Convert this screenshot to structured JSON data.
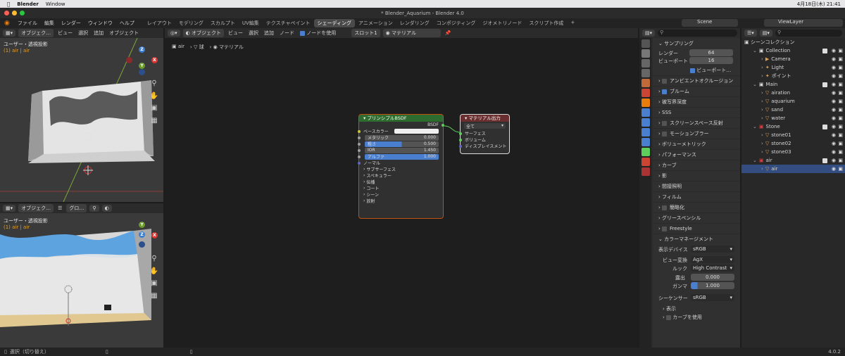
{
  "mac_menu": {
    "app": "Blender",
    "window": "Window",
    "clock": "4月18日(木) 21:41"
  },
  "window_title": "* Blender_Aquarium - Blender 4.0",
  "menus": [
    "ファイル",
    "編集",
    "レンダー",
    "ウィンドウ",
    "ヘルプ"
  ],
  "workspaces": [
    "レイアウト",
    "モデリング",
    "スカルプト",
    "UV編集",
    "テクスチャペイント",
    "シェーディング",
    "アニメーション",
    "レンダリング",
    "コンポジティング",
    "ジオメトリノード",
    "スクリプト作成"
  ],
  "active_workspace_index": 5,
  "add_tab": "+",
  "scene": {
    "label": "Scene",
    "viewlayer": "ViewLayer"
  },
  "viewport_top": {
    "mode": "オブジェク…",
    "menus": [
      "ビュー",
      "選択",
      "追加",
      "オブジェクト"
    ],
    "title": "ユーザー・透視投影",
    "subtitle": "(1) air | air"
  },
  "viewport_bottom": {
    "mode": "オブジェク…",
    "transform": "グロ…",
    "title": "ユーザー・透視投影",
    "subtitle": "(1) air | air"
  },
  "gizmo": {
    "z": "Z",
    "x": "X",
    "y": "Y"
  },
  "node_editor": {
    "mode": "オブジェクト",
    "menus": [
      "ビュー",
      "選択",
      "追加",
      "ノード"
    ],
    "use_nodes": "ノードを使用",
    "slot": "スロット1",
    "material": "マテリアル",
    "breadcrumb": [
      "air",
      "球",
      "マテリアル"
    ]
  },
  "bsdf_node": {
    "title": "プリンシプルBSDF",
    "output": "BSDF",
    "base_color": "ベースカラー",
    "metallic": {
      "label": "メタリック",
      "value": "0.000",
      "fill": 0.0
    },
    "roughness": {
      "label": "粗さ",
      "value": "0.500",
      "fill": 0.5
    },
    "ior": {
      "label": "IOR",
      "value": "1.450",
      "fill": 0.0
    },
    "alpha": {
      "label": "アルファ",
      "value": "1.000",
      "fill": 1.0
    },
    "normal": "ノーマル",
    "subpanels": [
      "サブサーフェス",
      "スペキュラー",
      "伝播",
      "コート",
      "シーン",
      "放射"
    ]
  },
  "output_node": {
    "title": "マテリアル出力",
    "target": "全て",
    "inputs": [
      "サーフェス",
      "ボリューム",
      "ディスプレイスメント"
    ]
  },
  "properties": {
    "sampling": "サンプリング",
    "render_label": "レンダー",
    "render_value": "64",
    "viewport_label": "ビューポート",
    "viewport_value": "16",
    "viewport_denoise": "ビューポート…",
    "sections": [
      {
        "label": "アンビエントオクルージョン",
        "check": "off"
      },
      {
        "label": "ブルーム",
        "check": "on"
      },
      {
        "label": "被写界深度",
        "check": "none"
      },
      {
        "label": "SSS",
        "check": "none"
      },
      {
        "label": "スクリーンスペース反射",
        "check": "off"
      },
      {
        "label": "モーションブラー",
        "check": "off"
      },
      {
        "label": "ボリューメトリック",
        "check": "none"
      },
      {
        "label": "パフォーマンス",
        "check": "none"
      },
      {
        "label": "カーブ",
        "check": "none"
      },
      {
        "label": "影",
        "check": "none"
      },
      {
        "label": "間接照明",
        "check": "none"
      },
      {
        "label": "フィルム",
        "check": "none"
      },
      {
        "label": "簡略化",
        "check": "off"
      },
      {
        "label": "グリースペンシル",
        "check": "none"
      },
      {
        "label": "Freestyle",
        "check": "off"
      }
    ],
    "color_management": "カラーマネージメント",
    "display_device_label": "表示デバイス",
    "display_device": "sRGB",
    "view_transform_label": "ビュー変換",
    "view_transform": "AgX",
    "look_label": "ルック",
    "look": "High Contrast",
    "exposure_label": "露出",
    "exposure": "0.000",
    "gamma_label": "ガンマ",
    "gamma": "1.000",
    "sequencer_label": "シーケンサー",
    "sequencer": "sRGB",
    "display": "表示",
    "use_curves": "カーブを使用"
  },
  "outliner": {
    "root": "シーンコレクション",
    "rows": [
      {
        "label": "Collection",
        "indent": 1,
        "kind": "collection",
        "color": "#d8d8d8"
      },
      {
        "label": "Camera",
        "indent": 2,
        "kind": "camera",
        "color": "#e0a050"
      },
      {
        "label": "Light",
        "indent": 2,
        "kind": "light",
        "color": "#e0a050"
      },
      {
        "label": "ポイント",
        "indent": 2,
        "kind": "light",
        "color": "#e0a050"
      },
      {
        "label": "Main",
        "indent": 1,
        "kind": "collection",
        "color": "#d8d8d8"
      },
      {
        "label": "airation",
        "indent": 2,
        "kind": "mesh",
        "color": "#e0a050"
      },
      {
        "label": "aquarium",
        "indent": 2,
        "kind": "mesh",
        "color": "#e0a050"
      },
      {
        "label": "sand",
        "indent": 2,
        "kind": "mesh",
        "color": "#e0a050"
      },
      {
        "label": "water",
        "indent": 2,
        "kind": "mesh",
        "color": "#e0a050"
      },
      {
        "label": "Stone",
        "indent": 1,
        "kind": "collection-red",
        "color": "#d8d8d8"
      },
      {
        "label": "stone01",
        "indent": 2,
        "kind": "mesh",
        "color": "#e0a050"
      },
      {
        "label": "stone02",
        "indent": 2,
        "kind": "mesh",
        "color": "#e0a050"
      },
      {
        "label": "stone03",
        "indent": 2,
        "kind": "mesh",
        "color": "#e0a050"
      },
      {
        "label": "air",
        "indent": 1,
        "kind": "collection-red",
        "color": "#d8d8d8"
      },
      {
        "label": "air",
        "indent": 2,
        "kind": "mesh",
        "color": "#e0a050",
        "selected": true
      }
    ]
  },
  "status_bar": {
    "left": "選択（切り替え）",
    "version": "4.0.2"
  },
  "colors": {
    "accent": "#4a7fd0",
    "bsdf_header": "#2e6b2e",
    "output_header": "#6b2e2e",
    "selected_row": "#334d80"
  }
}
